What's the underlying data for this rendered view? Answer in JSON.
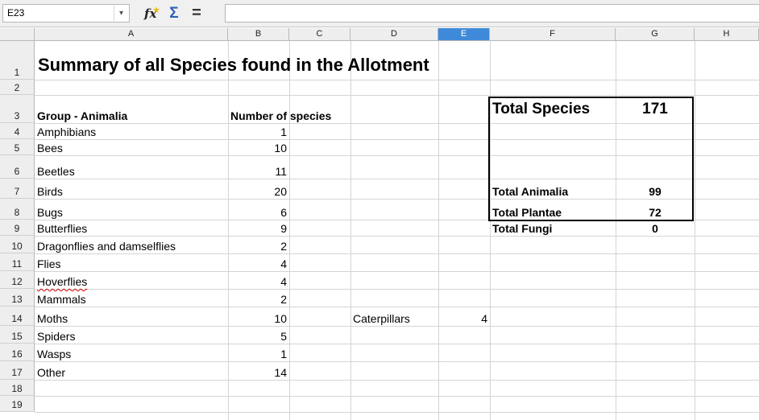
{
  "formula_bar": {
    "name_box": "E23",
    "function_wizard_glyph": "fx",
    "sum_glyph": "Σ",
    "formula_glyph": "=",
    "input_value": "",
    "icons": [
      "function-wizard-icon",
      "sum-icon",
      "formula-icon",
      "chevron-down-icon"
    ]
  },
  "columns": [
    "A",
    "B",
    "C",
    "D",
    "E",
    "F",
    "G",
    "H"
  ],
  "active_column": "E",
  "rows": [
    "1",
    "2",
    "3",
    "4",
    "5",
    "6",
    "7",
    "8",
    "9",
    "10",
    "11",
    "12",
    "13",
    "14",
    "15",
    "16",
    "17",
    "18",
    "19"
  ],
  "sheet": {
    "title": "Summary of all Species found in the Allotment",
    "group_header": "Group - Animalia",
    "count_header": "Number of species",
    "groups": [
      {
        "name": "Amphibians",
        "count": "1"
      },
      {
        "name": "Bees",
        "count": "10"
      },
      {
        "name": "Beetles",
        "count": "11"
      },
      {
        "name": "Birds",
        "count": "20"
      },
      {
        "name": "Bugs",
        "count": "6"
      },
      {
        "name": "Butterflies",
        "count": "9"
      },
      {
        "name": "Dragonflies and damselflies",
        "count": "2"
      },
      {
        "name": "Flies",
        "count": "4"
      },
      {
        "name": "Hoverflies",
        "count": "4"
      },
      {
        "name": "Mammals",
        "count": "2"
      },
      {
        "name": "Moths",
        "count": "10"
      },
      {
        "name": "Spiders",
        "count": "5"
      },
      {
        "name": "Wasps",
        "count": "1"
      },
      {
        "name": "Other",
        "count": "14"
      }
    ],
    "extra_label": "Caterpillars",
    "extra_value": "4",
    "totals": {
      "species_label": "Total Species",
      "species_value": "171",
      "animalia_label": "Total Animalia",
      "animalia_value": "99",
      "plantae_label": "Total Plantae",
      "plantae_value": "72",
      "fungi_label": "Total Fungi",
      "fungi_value": "0"
    }
  },
  "colors": {
    "active_header": "#3f8ad8",
    "header_bg": "#eeeeee",
    "grid_line": "#d4d4d4",
    "spellcheck_underline": "#d00000"
  }
}
